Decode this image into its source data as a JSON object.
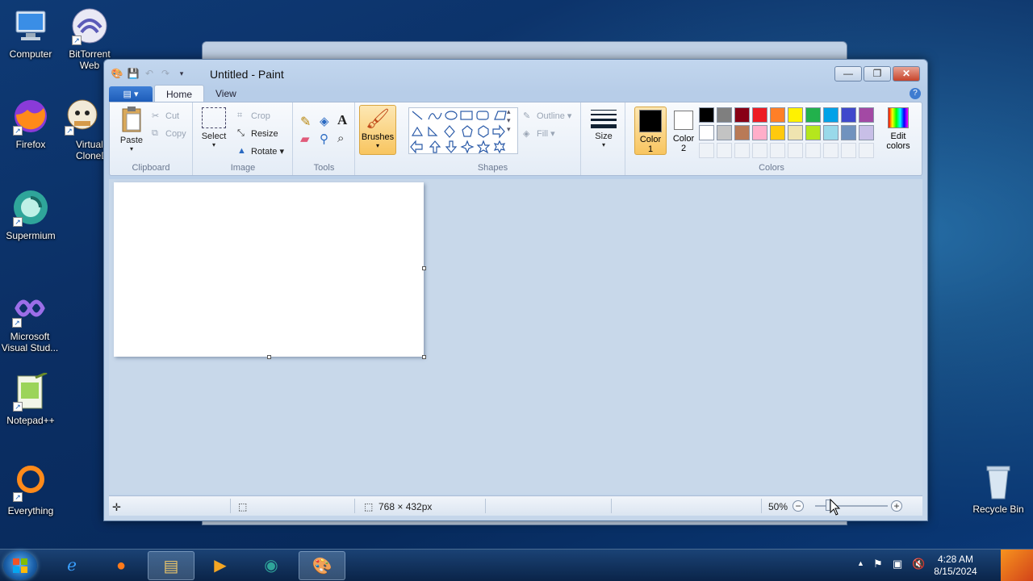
{
  "desktop": {
    "icons": [
      {
        "label": "Computer"
      },
      {
        "label": "BitTorrent Web"
      },
      {
        "label": "Firefox"
      },
      {
        "label": "Virtual CloneDrive"
      },
      {
        "label": "Supermium"
      },
      {
        "label": "Microsoft Visual Stud..."
      },
      {
        "label": "Notepad++"
      },
      {
        "label": "Everything"
      },
      {
        "label": "Recycle Bin"
      }
    ]
  },
  "window": {
    "title": "Untitled - Paint",
    "caption_buttons": {
      "minimize": "—",
      "maximize": "❐",
      "close": "✕"
    }
  },
  "ribbon": {
    "tabs": [
      {
        "label": "Home",
        "active": true
      },
      {
        "label": "View",
        "active": false
      }
    ],
    "clipboard": {
      "group_label": "Clipboard",
      "paste": "Paste",
      "cut": "Cut",
      "copy": "Copy"
    },
    "image": {
      "group_label": "Image",
      "select": "Select",
      "crop": "Crop",
      "resize": "Resize",
      "rotate": "Rotate"
    },
    "tools": {
      "group_label": "Tools"
    },
    "brushes": {
      "label": "Brushes"
    },
    "shapes": {
      "group_label": "Shapes",
      "outline": "Outline",
      "fill": "Fill"
    },
    "size": {
      "label": "Size"
    },
    "colors": {
      "group_label": "Colors",
      "color1_label": "Color 1",
      "color1": "#000000",
      "color2_label": "Color 2",
      "color2": "#ffffff",
      "edit_colors": "Edit colors",
      "palette_row1": [
        "#000000",
        "#7f7f7f",
        "#880015",
        "#ed1c24",
        "#ff7f27",
        "#fff200",
        "#22b14c",
        "#00a2e8",
        "#3f48cc",
        "#a349a4"
      ],
      "palette_row2": [
        "#ffffff",
        "#c3c3c3",
        "#b97a57",
        "#ffaec9",
        "#ffc90e",
        "#efe4b0",
        "#b5e61d",
        "#99d9ea",
        "#7092be",
        "#c8bfe7"
      ]
    }
  },
  "statusbar": {
    "image_size": "768 × 432px",
    "zoom": "50%"
  },
  "taskbar": {
    "time": "4:28 AM",
    "date": "8/15/2024"
  }
}
